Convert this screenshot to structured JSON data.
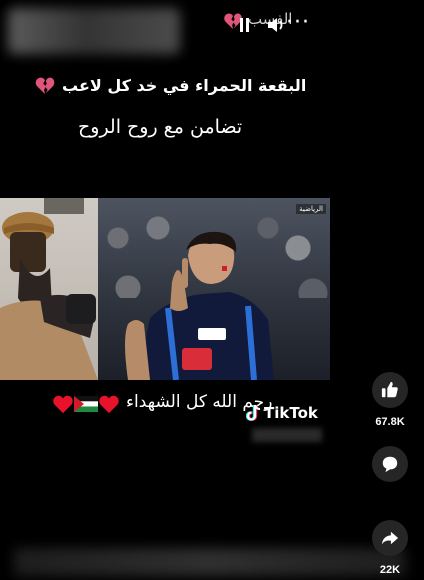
{
  "top": {
    "blurred_title": "",
    "label": "الفسب"
  },
  "captions": {
    "line1": "البقعة الحمراء في خد كل لاعب",
    "line2": "تضامن مع روح الروح",
    "line3": "رحم الله كل الشهداء"
  },
  "video": {
    "channel_tag": "الرياضية"
  },
  "watermark": {
    "brand": "TikTok"
  },
  "actions": {
    "likes": "67.8K",
    "shares": "22K"
  },
  "colors": {
    "heart_broken": "#e0567a",
    "heart_red": "#e8132a",
    "palestine_red": "#d11b2a",
    "palestine_green": "#1e8a3d"
  }
}
